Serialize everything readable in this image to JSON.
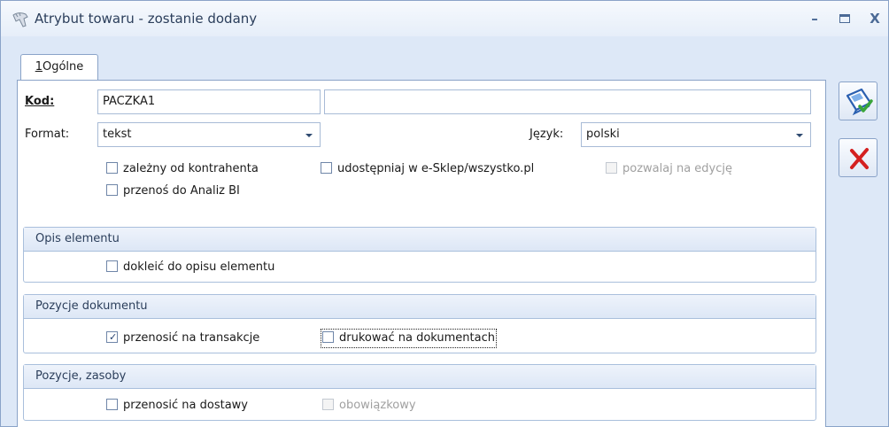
{
  "window": {
    "title": "Atrybut towaru - zostanie dodany",
    "minimize_icon": "minimize-icon",
    "maximize_icon": "maximize-icon",
    "close_label": "X"
  },
  "tabs": [
    {
      "hotkey": "1",
      "label": "Ogólne"
    }
  ],
  "form": {
    "kod_label": "Kod:",
    "kod_value": "PACZKA1",
    "kod_description_value": "",
    "format_label": "Format:",
    "format_value": "tekst",
    "jezyk_label": "Język:",
    "jezyk_value": "polski"
  },
  "options": {
    "zalezny": {
      "label": "zależny od kontrahenta",
      "checked": false,
      "enabled": true
    },
    "udostepniaj": {
      "label": "udostępniaj w e-Sklep/wszystko.pl",
      "checked": false,
      "enabled": true
    },
    "pozwalaj": {
      "label": "pozwalaj na edycję",
      "checked": false,
      "enabled": false
    },
    "przenos_bi": {
      "label": "przenoś do Analiz BI",
      "checked": false,
      "enabled": true
    }
  },
  "groups": {
    "opis": {
      "title": "Opis elementu",
      "dokleic": {
        "label": "dokleić do opisu elementu",
        "checked": false,
        "enabled": true
      }
    },
    "pozycje_dokumentu": {
      "title": "Pozycje dokumentu",
      "przenosic_transakcje": {
        "label": "przenosić na transakcje",
        "checked": true,
        "enabled": true
      },
      "drukowac": {
        "label": "drukować na dokumentach",
        "checked": false,
        "enabled": true
      }
    },
    "pozycje_zasoby": {
      "title": "Pozycje, zasoby",
      "przenosic_dostawy": {
        "label": "przenosić na dostawy",
        "checked": false,
        "enabled": true
      },
      "obowiazkowy": {
        "label": "obowiązkowy",
        "checked": false,
        "enabled": false
      }
    }
  },
  "actions": {
    "save_icon": "save-icon",
    "cancel_icon": "cancel-icon"
  },
  "colors": {
    "accent": "#4b6a96",
    "save_green": "#3aa53a",
    "cancel_red": "#d42020"
  }
}
